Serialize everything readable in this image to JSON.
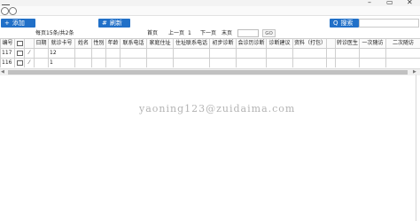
{
  "window": {
    "minimize_glyph": "–",
    "maximize_glyph": "▭",
    "close_glyph": "✕"
  },
  "toolbar": {
    "add_icon": "+",
    "add_label": "添加",
    "refresh_icon": "#",
    "refresh_label": "刷新",
    "search_icon": "Q",
    "search_label": "搜索",
    "search_value": ""
  },
  "pager": {
    "summary": "每页15条/共2条",
    "first": "首页",
    "prev": "上一页",
    "current": "1",
    "next": "下一页",
    "last": "末页",
    "page_input": "",
    "go": "GO"
  },
  "table": {
    "headers": [
      "编号",
      "",
      "",
      "日期",
      "就诊卡号",
      "姓名",
      "性别",
      "年龄",
      "联系电话",
      "家庭住址",
      "住址联系电话",
      "初步诊断",
      "会诊历诊断",
      "诊断建议",
      "资料（打包）",
      "",
      "转诊医生",
      "一次随访",
      "二次随访"
    ],
    "rows": [
      {
        "id": "117",
        "date": "",
        "card": "12",
        "name": "",
        "sex": "",
        "age": "",
        "phone": "",
        "address": "",
        "addr_phone": "",
        "diag": "",
        "consult": "",
        "advice": "",
        "material": "",
        "blank": "",
        "doctor": "",
        "visit1": "",
        "visit2": ""
      },
      {
        "id": "116",
        "date": "",
        "card": "1",
        "name": "",
        "sex": "",
        "age": "",
        "phone": "",
        "address": "",
        "addr_phone": "",
        "diag": "",
        "consult": "",
        "advice": "",
        "material": "",
        "blank": "",
        "doctor": "",
        "visit1": "",
        "visit2": ""
      }
    ]
  },
  "scrollbar": {
    "left_arrow": "◀",
    "right_arrow": "▶"
  },
  "watermark": "yaoning123@zuidaima.com"
}
